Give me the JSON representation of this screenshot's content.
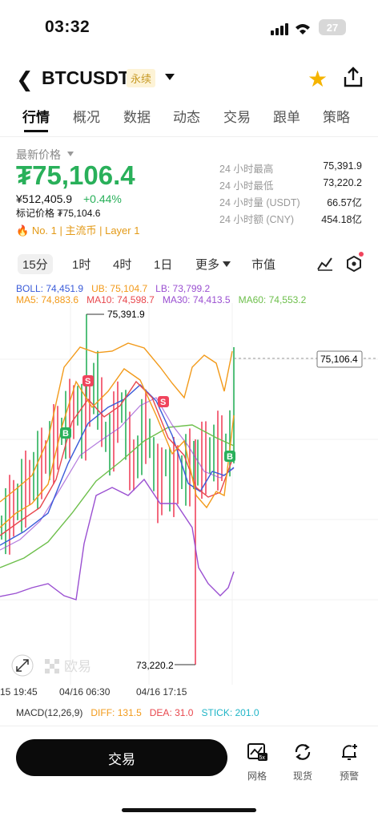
{
  "status": {
    "time": "03:32",
    "battery": "27"
  },
  "header": {
    "symbol": "BTCUSDT",
    "badge": "永续"
  },
  "tabs": [
    "行情",
    "概况",
    "数据",
    "动态",
    "交易",
    "跟单",
    "策略"
  ],
  "price": {
    "label": "最新价格",
    "last": "₮75,106.4",
    "cny": "¥512,405.9",
    "change": "+0.44%",
    "mark": "标记价格 ₮75,104.6",
    "tags": "No. 1  |  主流币  |  Layer 1"
  },
  "stats": [
    {
      "k": "24 小时最高",
      "v": "75,391.9"
    },
    {
      "k": "24 小时最低",
      "v": "73,220.2"
    },
    {
      "k": "24 小时量 (USDT)",
      "v": "66.57亿"
    },
    {
      "k": "24 小时额 (CNY)",
      "v": "454.18亿"
    }
  ],
  "timeframes": {
    "m15": "15分",
    "h1": "1时",
    "h4": "4时",
    "d1": "1日",
    "more": "更多",
    "mcap": "市值"
  },
  "indicators": {
    "boll": "BOLL: 74,451.9",
    "ub": "UB: 75,104.7",
    "lb": "LB: 73,799.2",
    "ma5": "MA5: 74,883.6",
    "ma10": "MA10: 74,598.7",
    "ma30": "MA30: 74,413.5",
    "ma60": "MA60: 74,553.2"
  },
  "chart": {
    "high_label": "75,391.9",
    "low_label": "73,220.2",
    "last_label": "75,106.4",
    "watermark": "欧易",
    "dates": [
      "15 19:45",
      "04/16 06:30",
      "04/16 17:15"
    ],
    "marker_b": "B",
    "marker_s": "S"
  },
  "macd": {
    "label": "MACD(12,26,9)",
    "diff": "DIFF: 131.5",
    "dea": "DEA: 31.0",
    "stick": "STICK: 201.0"
  },
  "bottom": {
    "trade": "交易",
    "grid": "网格",
    "spot": "现货",
    "alert": "预警",
    "grid_badge": "5x"
  },
  "colors": {
    "up": "#29b05a",
    "down": "#f0445d",
    "boll": "#3a5bd9",
    "ub": "#f29a1a",
    "lb": "#9a4fd1",
    "ma5": "#f29a1a",
    "ma10": "#e8474d",
    "ma30": "#9a4fd1",
    "ma60": "#6dbf4b"
  }
}
